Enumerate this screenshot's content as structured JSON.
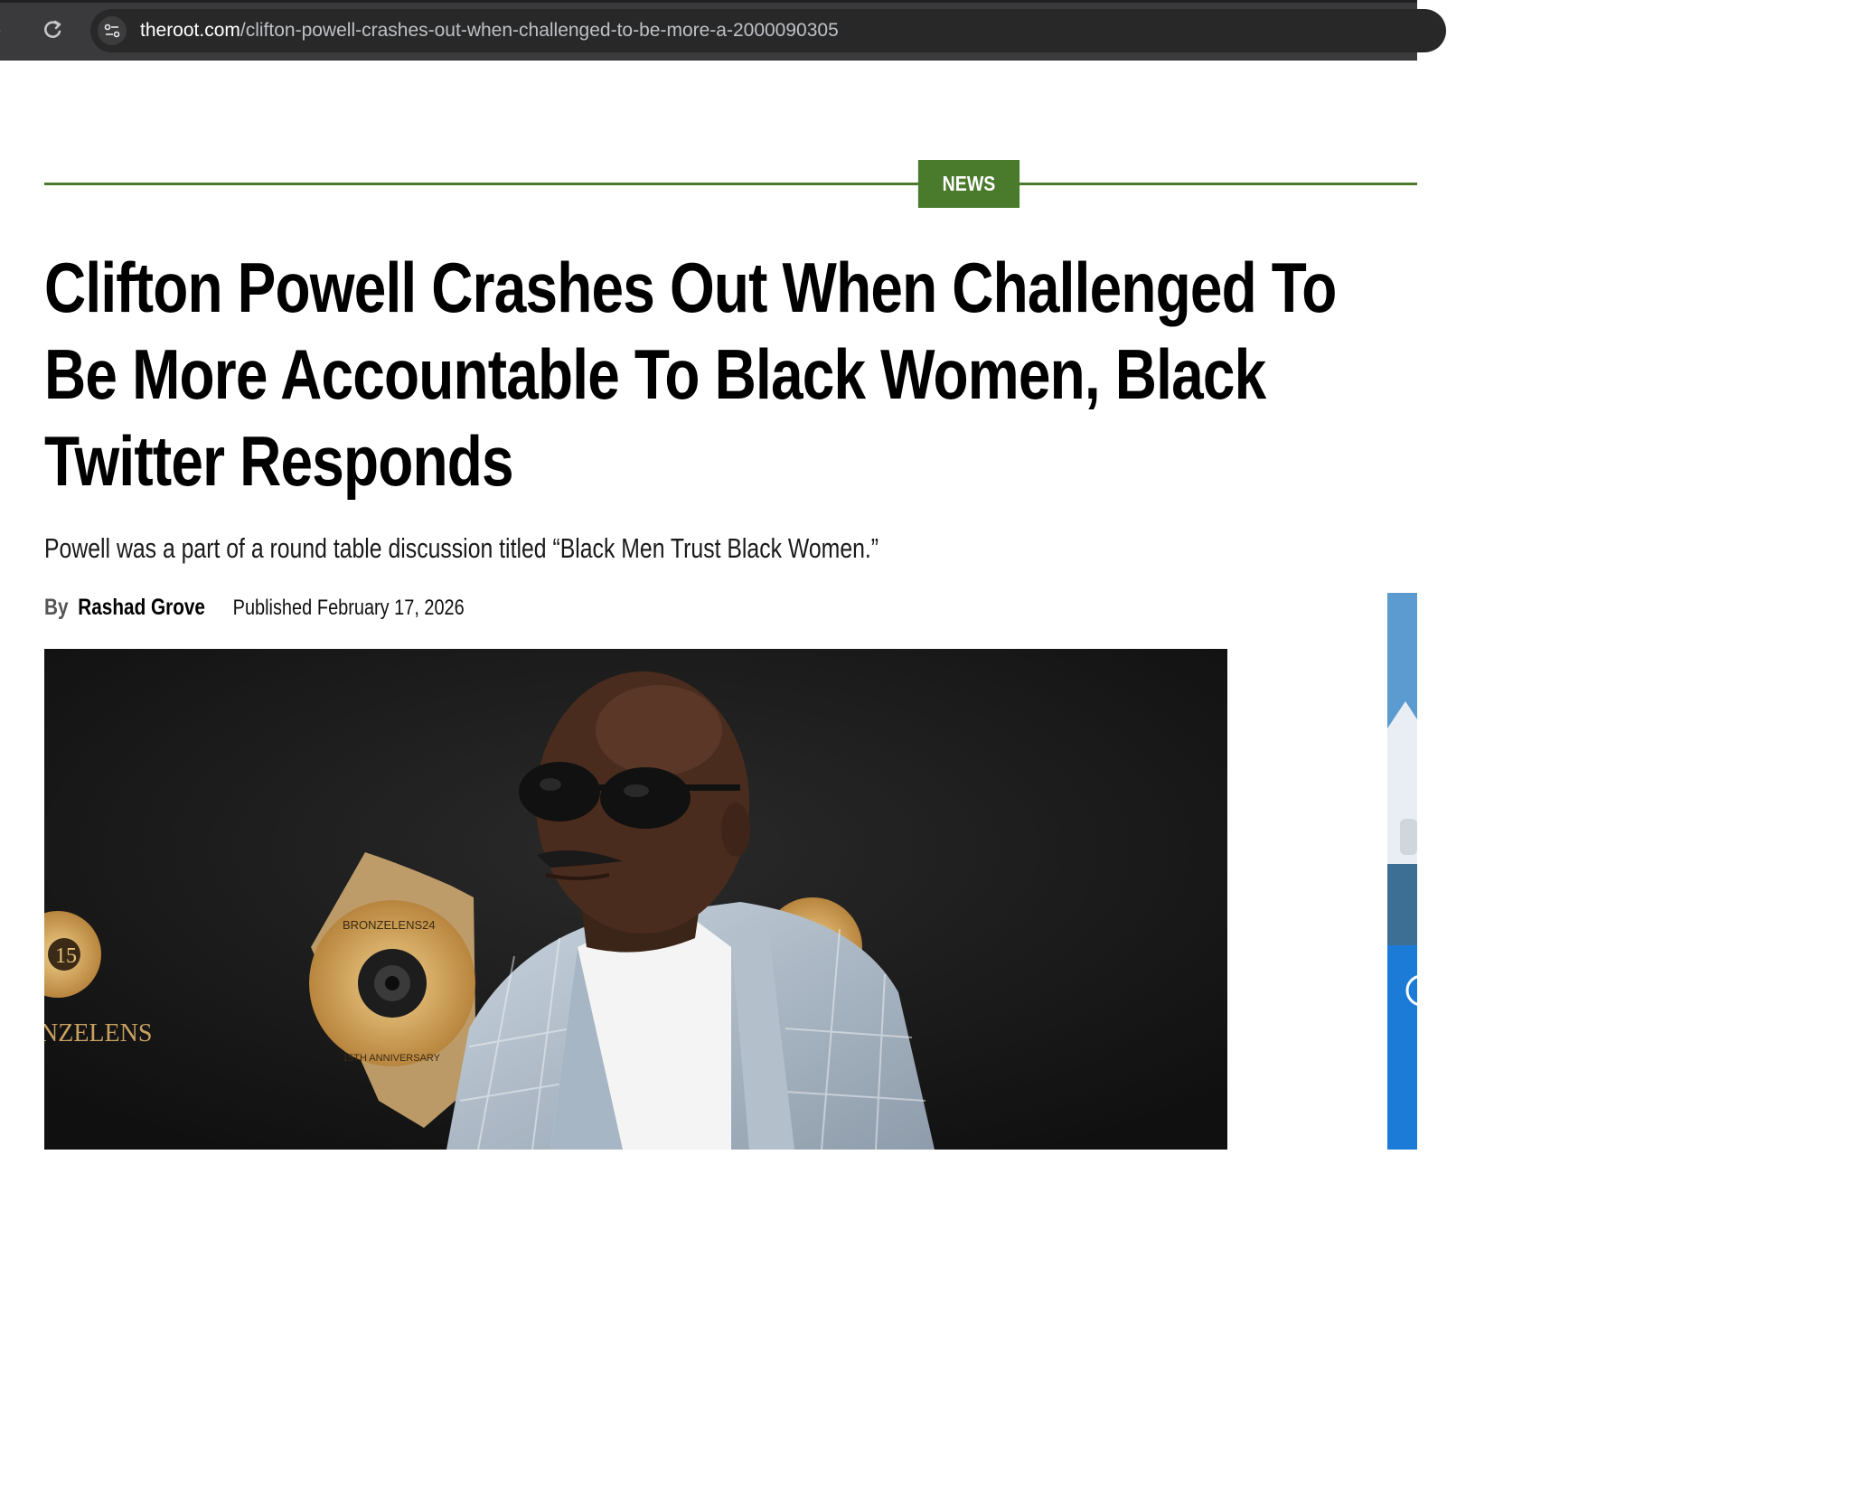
{
  "browser": {
    "url_host": "theroot.com",
    "url_path": "/clifton-powell-crashes-out-when-challenged-to-be-more-a-2000090305"
  },
  "article": {
    "section": "NEWS",
    "headline_lines": [
      "Clifton Powell Crashes Out When Challenged To",
      "Be More Accountable To Black Women, Black",
      "Twitter Responds"
    ],
    "dek": "Powell was a part of a round table discussion titled “Black Men Trust Black Women.”",
    "by_label": "By",
    "author": "Rashad Grove",
    "published_label": "Published",
    "published_date": "February 17, 2026"
  },
  "hero_image": {
    "backdrop_text_1": "BRONZELENS24",
    "backdrop_text_2": "15TH ANNIVERSARY",
    "backdrop_text_3": "NZELENS",
    "backdrop_text_4": "15"
  },
  "colors": {
    "accent": "#4a7a2c",
    "chrome": "#3a3a3c"
  }
}
